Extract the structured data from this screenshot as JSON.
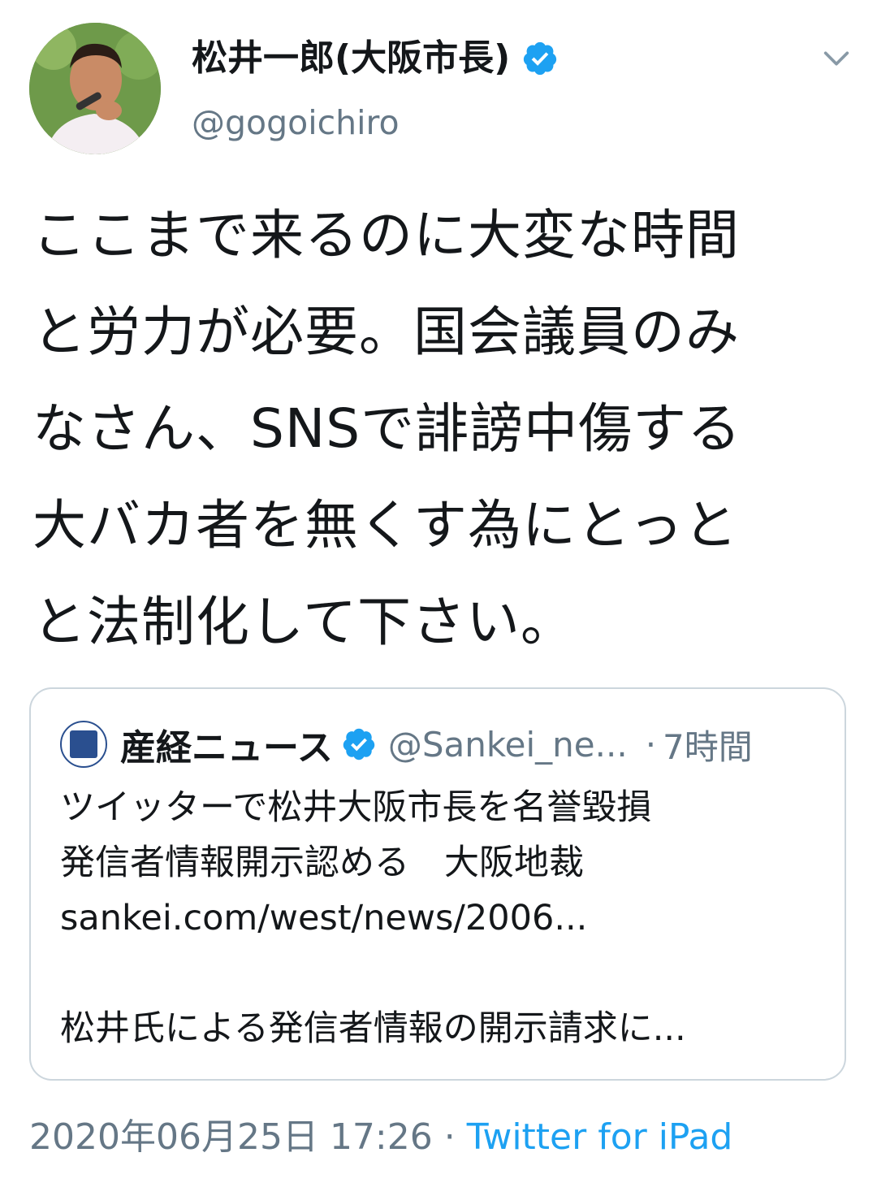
{
  "author": {
    "display_name": "松井一郎(大阪市長)",
    "handle": "@gogoichiro",
    "verified": true
  },
  "tweet": {
    "lines": [
      "ここまで来るのに大変な時間",
      "と労力が必要。国会議員のみ",
      "なさん、SNSで誹謗中傷する",
      "大バカ者を無くす為にとっと",
      "と法制化して下さい。"
    ]
  },
  "quoted_tweet": {
    "name": "産経ニュース",
    "handle": "@Sankei_ne...",
    "separator": "·",
    "time": "7時間",
    "lines": [
      "ツイッターで松井大阪市長を名誉毀損",
      "発信者情報開示認める　大阪地裁",
      "sankei.com/west/news/2006..."
    ],
    "preview": "松井氏による発信者情報の開示請求に..."
  },
  "meta": {
    "timestamp": "2020年06月25日 17:26",
    "separator": "·",
    "client": "Twitter for iPad"
  },
  "icons": {
    "verified": "verified-badge-icon",
    "menu": "chevron-down-icon"
  },
  "colors": {
    "verified": "#1da1f2",
    "link": "#1da1f2",
    "muted": "#657786",
    "text": "#14171a"
  }
}
